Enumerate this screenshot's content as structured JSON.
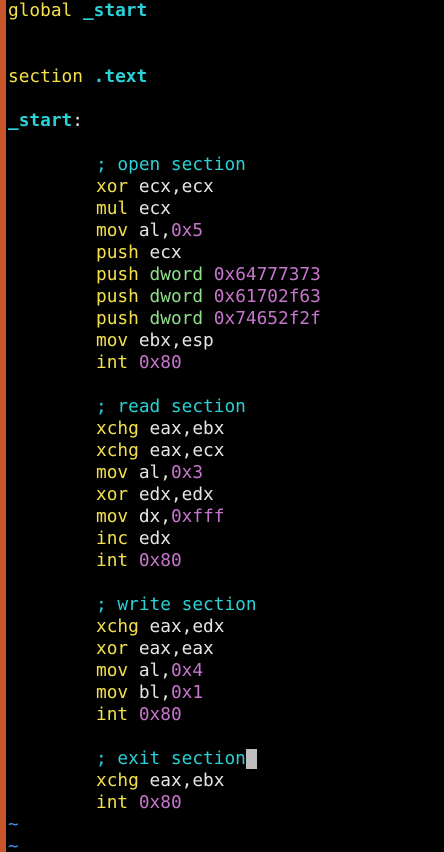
{
  "editor": {
    "global_kw": "global",
    "global_sym": "_start",
    "section_kw": "section",
    "section_name": ".text",
    "start_label": "_start",
    "start_colon": ":",
    "open_comment": "; open section",
    "open_lines": [
      {
        "op": "xor",
        "args": " ecx,ecx"
      },
      {
        "op": "mul",
        "args": " ecx"
      },
      {
        "op": "mov",
        "args": " al,",
        "num": "0x5"
      },
      {
        "op": "push",
        "args": " ecx"
      },
      {
        "op": "push",
        "args": " ",
        "dword": "dword",
        "num": " 0x64777373"
      },
      {
        "op": "push",
        "args": " ",
        "dword": "dword",
        "num": " 0x61702f63"
      },
      {
        "op": "push",
        "args": " ",
        "dword": "dword",
        "num": " 0x74652f2f"
      },
      {
        "op": "mov",
        "args": " ebx,esp"
      },
      {
        "op": "int",
        "args": " ",
        "num": "0x80"
      }
    ],
    "read_comment": "; read section",
    "read_lines": [
      {
        "op": "xchg",
        "args": " eax,ebx"
      },
      {
        "op": "xchg",
        "args": " eax,ecx"
      },
      {
        "op": "mov",
        "args": " al,",
        "num": "0x3"
      },
      {
        "op": "xor",
        "args": " edx,edx"
      },
      {
        "op": "mov",
        "args": " dx,",
        "num": "0xfff"
      },
      {
        "op": "inc",
        "args": " edx"
      },
      {
        "op": "int",
        "args": " ",
        "num": "0x80"
      }
    ],
    "write_comment": "; write section",
    "write_lines": [
      {
        "op": "xchg",
        "args": " eax,edx"
      },
      {
        "op": "xor",
        "args": " eax,eax"
      },
      {
        "op": "mov",
        "args": " al,",
        "num": "0x4"
      },
      {
        "op": "mov",
        "args": " bl,",
        "num": "0x1"
      },
      {
        "op": "int",
        "args": " ",
        "num": "0x80"
      }
    ],
    "exit_comment": "; exit section",
    "exit_lines": [
      {
        "op": "xchg",
        "args": " eax,ebx"
      },
      {
        "op": "int",
        "args": " ",
        "num": "0x80"
      }
    ],
    "empty_marker": "~"
  },
  "colors": {
    "background": "#000000",
    "gutter": "#c8562a",
    "keyword": "#f5e04a",
    "label": "#2ad1d6",
    "number": "#c774cc",
    "dword": "#8fe08a",
    "tilde": "#3f8df0"
  }
}
